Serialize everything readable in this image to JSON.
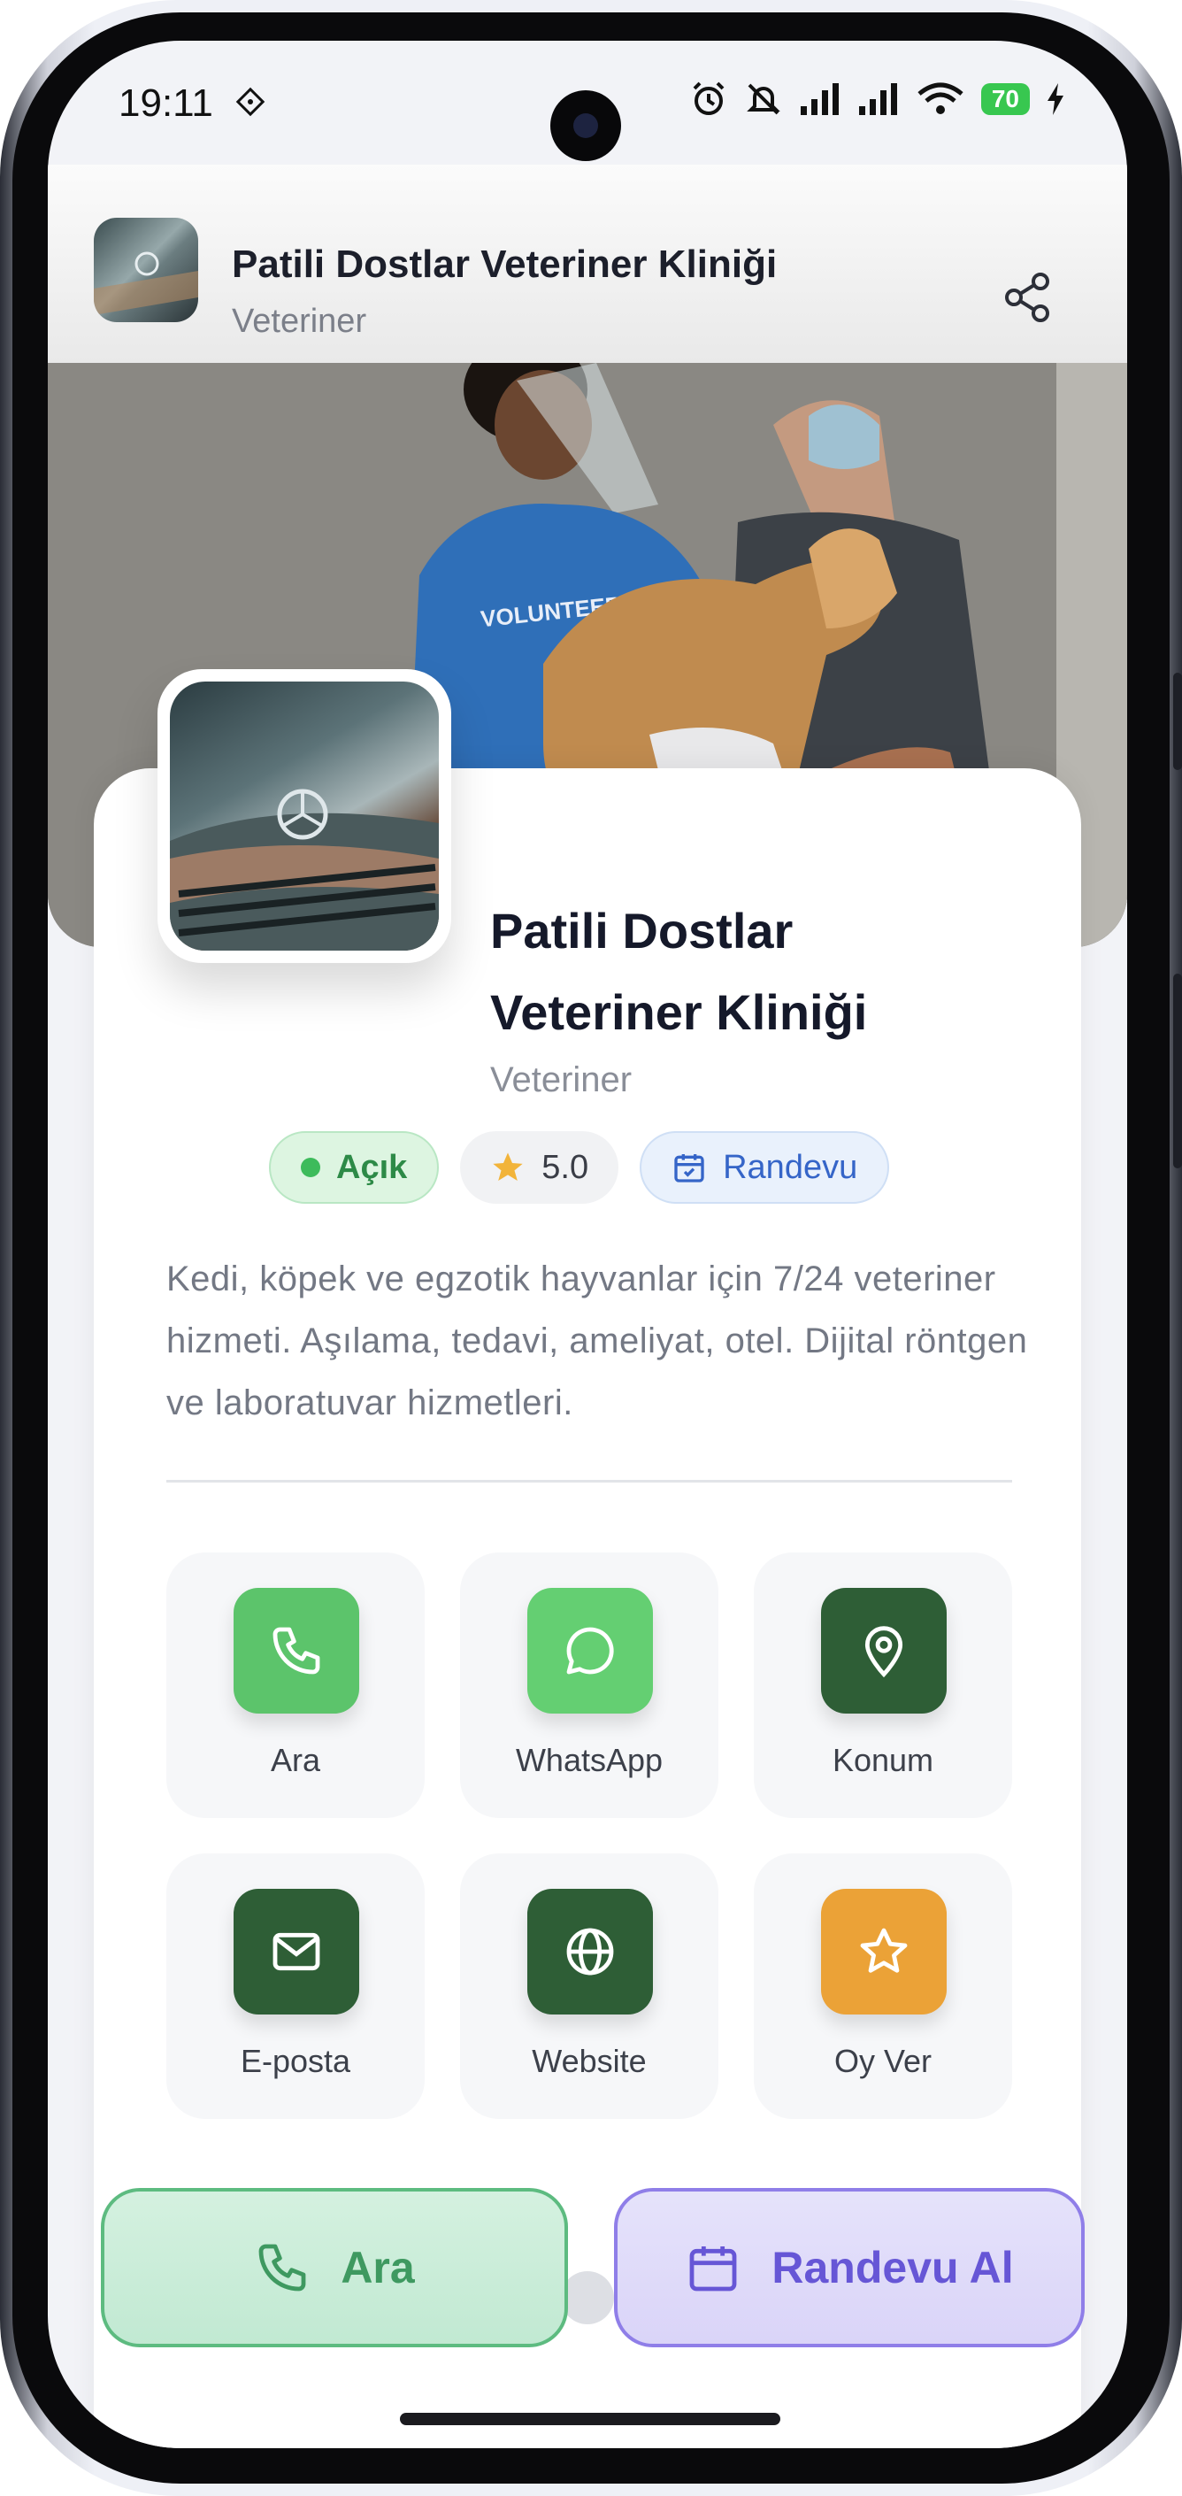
{
  "status_bar": {
    "time": "19:11",
    "battery": "70"
  },
  "app_bar": {
    "title": "Patili Dostlar Veteriner Kliniği",
    "subtitle": "Veteriner"
  },
  "hero": {
    "shirt_text": "VOLUNTEER"
  },
  "business": {
    "name_line1": "Patili Dostlar",
    "name_line2": "Veteriner Kliniği",
    "category": "Veteriner",
    "chips": {
      "open": "Açık",
      "rating": "5.0",
      "appointment": "Randevu"
    },
    "description": "Kedi, köpek ve egzotik hayvanlar için 7/24 veteriner hizmeti. Aşılama, tedavi, ameliyat, otel. Dijital röntgen ve laboratuvar hizmetleri."
  },
  "actions": [
    {
      "label": "Ara",
      "icon": "phone-icon",
      "color": "#5cc46b"
    },
    {
      "label": "WhatsApp",
      "icon": "whatsapp-icon",
      "color": "#64cf72"
    },
    {
      "label": "Konum",
      "icon": "location-pin-icon",
      "color": "#2e5e36"
    },
    {
      "label": "E-posta",
      "icon": "mail-icon",
      "color": "#2e5e36"
    },
    {
      "label": "Website",
      "icon": "globe-icon",
      "color": "#2e5e36"
    },
    {
      "label": "Oy Ver",
      "icon": "star-icon",
      "color": "#eba237"
    }
  ],
  "bottom_buttons": {
    "call": "Ara",
    "appointment": "Randevu Al"
  }
}
